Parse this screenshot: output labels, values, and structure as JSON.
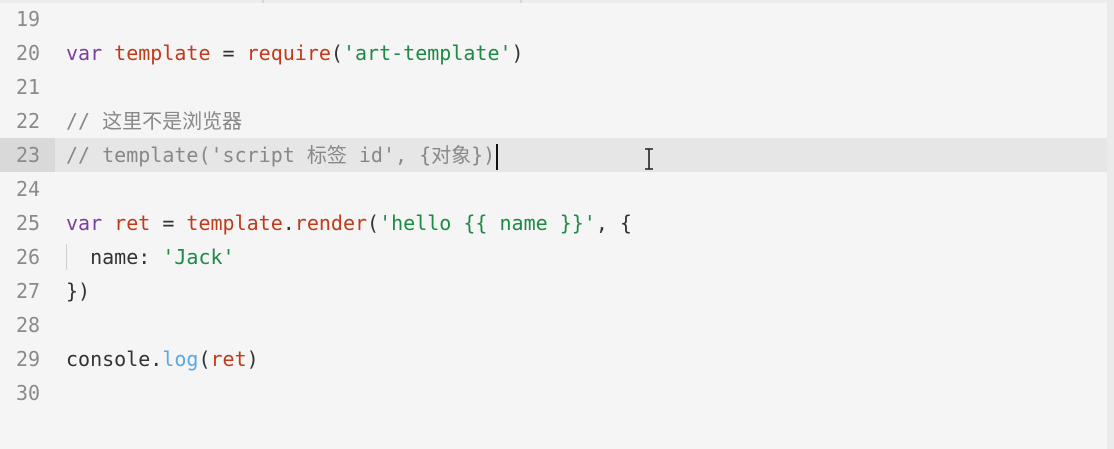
{
  "editor": {
    "current_line": 23,
    "lines": [
      {
        "num": "19",
        "tokens": []
      },
      {
        "num": "20",
        "tokens": [
          {
            "t": "var",
            "c": "kw"
          },
          {
            "t": " ",
            "c": "prop"
          },
          {
            "t": "template",
            "c": "var"
          },
          {
            "t": " = ",
            "c": "prop"
          },
          {
            "t": "require",
            "c": "fn"
          },
          {
            "t": "(",
            "c": "prop"
          },
          {
            "t": "'art-template'",
            "c": "str"
          },
          {
            "t": ")",
            "c": "prop"
          }
        ]
      },
      {
        "num": "21",
        "tokens": []
      },
      {
        "num": "22",
        "tokens": [
          {
            "t": "// 这里不是浏览器",
            "c": "com"
          }
        ]
      },
      {
        "num": "23",
        "tokens": [
          {
            "t": "// template('script 标签 id', {对象})",
            "c": "com"
          }
        ]
      },
      {
        "num": "24",
        "tokens": []
      },
      {
        "num": "25",
        "tokens": [
          {
            "t": "var",
            "c": "kw"
          },
          {
            "t": " ",
            "c": "prop"
          },
          {
            "t": "ret",
            "c": "var"
          },
          {
            "t": " = ",
            "c": "prop"
          },
          {
            "t": "template",
            "c": "var"
          },
          {
            "t": ".",
            "c": "prop"
          },
          {
            "t": "render",
            "c": "fn"
          },
          {
            "t": "(",
            "c": "prop"
          },
          {
            "t": "'hello {{ name }}'",
            "c": "str"
          },
          {
            "t": ", {",
            "c": "prop"
          }
        ]
      },
      {
        "num": "26",
        "tokens": [
          {
            "t": "  name: ",
            "c": "prop"
          },
          {
            "t": "'Jack'",
            "c": "str"
          }
        ]
      },
      {
        "num": "27",
        "tokens": [
          {
            "t": "})",
            "c": "prop"
          }
        ]
      },
      {
        "num": "28",
        "tokens": []
      },
      {
        "num": "29",
        "tokens": [
          {
            "t": "console.",
            "c": "prop"
          },
          {
            "t": "log",
            "c": "method-light"
          },
          {
            "t": "(",
            "c": "prop"
          },
          {
            "t": "ret",
            "c": "var"
          },
          {
            "t": ")",
            "c": "prop"
          }
        ]
      },
      {
        "num": "30",
        "tokens": []
      }
    ]
  },
  "icons": {
    "caret": "text-caret-icon",
    "cursor": "ibeam-cursor-icon"
  },
  "colors": {
    "background": "#f5f5f5",
    "current_line": "#e6e6e6",
    "keyword": "#7a3e9d",
    "identifier": "#c33a1a",
    "string": "#1e8a45",
    "comment": "#888888"
  }
}
